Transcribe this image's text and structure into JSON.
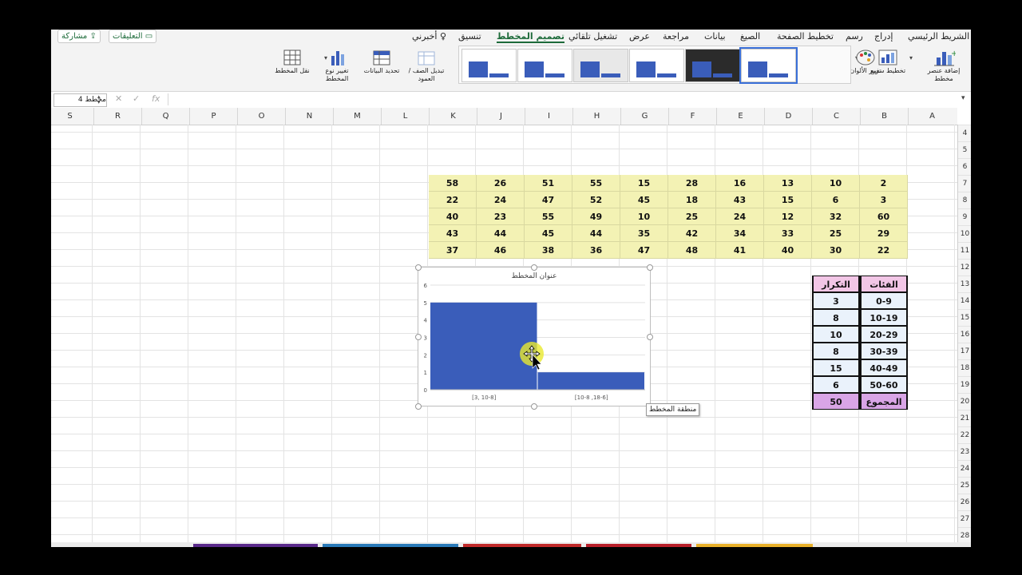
{
  "ribbon": {
    "tabs": [
      "الشريط الرئيسي",
      "إدراج",
      "رسم",
      "تخطيط الصفحة",
      "الصيغ",
      "بيانات",
      "مراجعة",
      "عرض",
      "تشغيل تلقائي",
      "تصميم المخطط",
      "تنسيق",
      "أخبرني"
    ],
    "active_tab": "تصميم المخطط",
    "comments_label": "التعليقات",
    "share_label": "مشاركة",
    "buttons": {
      "add_element": "إضافة عنصر مخطط",
      "quick_layout": "تخطيط سريع",
      "change_colors": "تغيير الألوان",
      "switch_row_col": "تبديل الصف /العمود",
      "select_data": "تحديد البيانات",
      "change_type": "تغيير نوع المخطط",
      "move_chart": "نقل المخطط"
    }
  },
  "formula_bar": {
    "name_box": "مخطط 4",
    "fx": "fx",
    "cancel": "✕",
    "enter": "✓"
  },
  "columns": [
    "A",
    "B",
    "C",
    "D",
    "E",
    "F",
    "G",
    "H",
    "I",
    "J",
    "K",
    "L",
    "M",
    "N",
    "O",
    "P",
    "Q",
    "R",
    "S"
  ],
  "rows": [
    4,
    5,
    6,
    7,
    8,
    9,
    10,
    11,
    12,
    13,
    14,
    15,
    16,
    17,
    18,
    19,
    20,
    21,
    22,
    23,
    24,
    25,
    26,
    27,
    28
  ],
  "data_table": [
    [
      "2",
      "10",
      "13",
      "16",
      "28",
      "15",
      "55",
      "51",
      "26",
      "58"
    ],
    [
      "3",
      "6",
      "15",
      "43",
      "18",
      "45",
      "52",
      "47",
      "24",
      "22"
    ],
    [
      "60",
      "32",
      "12",
      "24",
      "25",
      "10",
      "49",
      "55",
      "23",
      "40"
    ],
    [
      "29",
      "25",
      "33",
      "34",
      "42",
      "35",
      "44",
      "45",
      "44",
      "43"
    ],
    [
      "22",
      "30",
      "40",
      "41",
      "48",
      "47",
      "36",
      "38",
      "46",
      "37"
    ]
  ],
  "freq_table": {
    "header_category": "الفئات",
    "header_frequency": "التكرار",
    "rows": [
      [
        "0-9",
        "3"
      ],
      [
        "10-19",
        "8"
      ],
      [
        "20-29",
        "10"
      ],
      [
        "30-39",
        "8"
      ],
      [
        "40-49",
        "15"
      ],
      [
        "50-60",
        "6"
      ]
    ],
    "total_label": "المجموع",
    "total_value": "50"
  },
  "chart_data": {
    "type": "bar",
    "title": "عنوان المخطط",
    "categories": [
      "[3, 10-8]",
      "[10-8 ,18-6]"
    ],
    "values": [
      5,
      1
    ],
    "ylim": [
      0,
      6
    ],
    "yticks": [
      "0",
      "1",
      "2",
      "3",
      "4",
      "5",
      "6"
    ],
    "grid": true,
    "color": "#3a5dba"
  },
  "tooltip": "منطقة المخطط",
  "colors": {
    "accent": "#1d6b3a",
    "data_fill": "#f3f2b4",
    "header_fill": "#f2c6e6",
    "total_fill": "#d9a5e6",
    "freq_row_fill": "#eaf2fb"
  }
}
